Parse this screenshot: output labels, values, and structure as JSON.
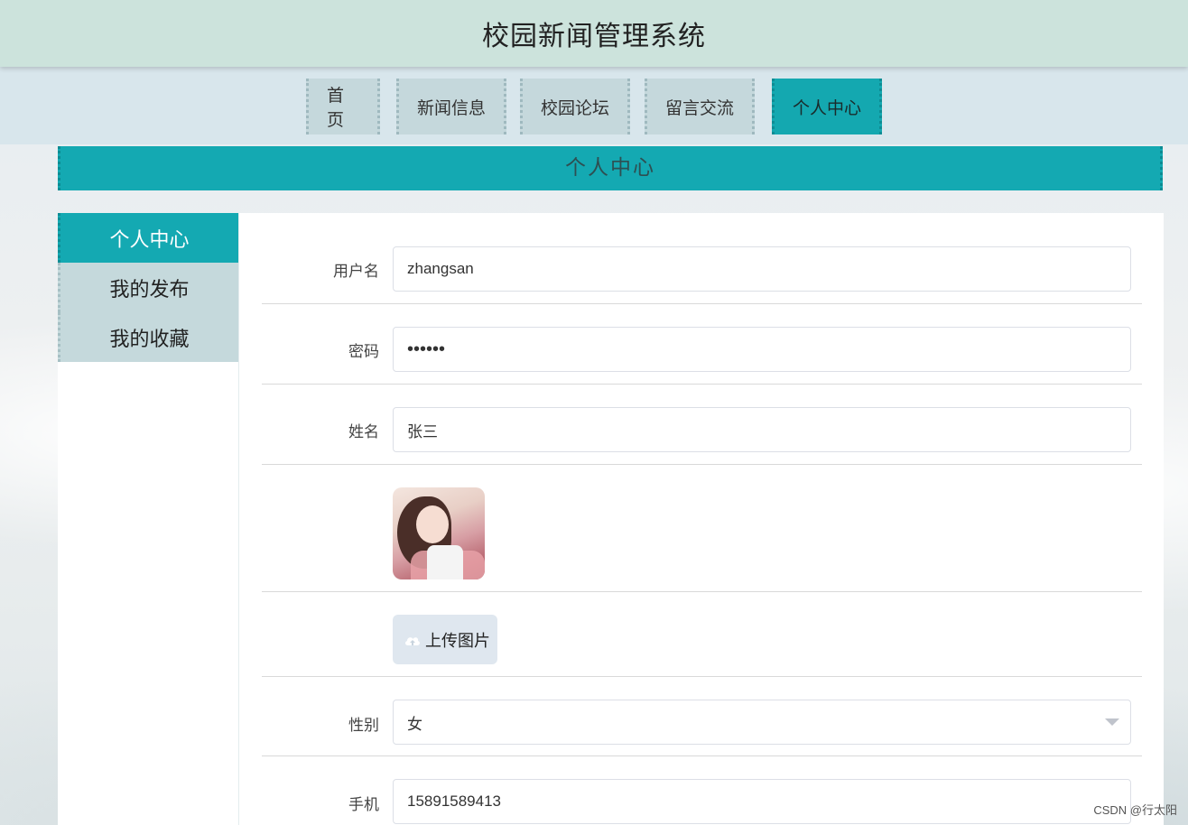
{
  "header": {
    "title": "校园新闻管理系统"
  },
  "nav": {
    "items": [
      {
        "label": "首页",
        "active": false
      },
      {
        "label": "新闻信息",
        "active": false
      },
      {
        "label": "校园论坛",
        "active": false
      },
      {
        "label": "留言交流",
        "active": false
      },
      {
        "label": "个人中心",
        "active": true
      }
    ]
  },
  "banner": {
    "title": "个人中心"
  },
  "sidebar": {
    "items": [
      {
        "label": "个人中心",
        "active": true
      },
      {
        "label": "我的发布",
        "active": false
      },
      {
        "label": "我的收藏",
        "active": false
      }
    ]
  },
  "form": {
    "username": {
      "label": "用户名",
      "value": "zhangsan"
    },
    "password": {
      "label": "密码",
      "value": "••••••"
    },
    "name": {
      "label": "姓名",
      "value": "张三"
    },
    "upload": {
      "label": "上传图片",
      "icon": "cloud-upload-icon"
    },
    "gender": {
      "label": "性别",
      "value": "女"
    },
    "phone": {
      "label": "手机",
      "value": "15891589413"
    }
  },
  "watermark": "CSDN @行太阳",
  "colors": {
    "accent": "#14a9b2",
    "header_bg": "#cce3dc",
    "nav_bg": "#c5d8dc"
  }
}
